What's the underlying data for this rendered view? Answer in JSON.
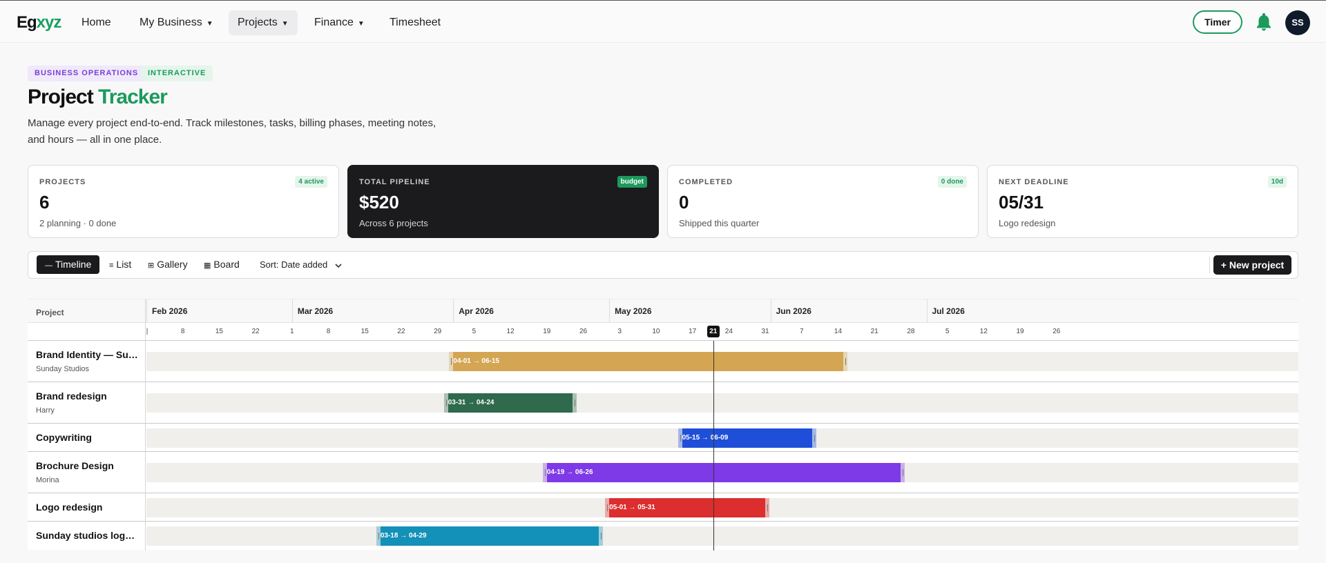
{
  "brand": {
    "prefix": "Eg",
    "suffix": "xyz"
  },
  "nav": [
    {
      "label": "Home",
      "dropdown": false
    },
    {
      "label": "My Business",
      "dropdown": true
    },
    {
      "label": "Projects",
      "dropdown": true,
      "active": true
    },
    {
      "label": "Finance",
      "dropdown": true
    },
    {
      "label": "Timesheet",
      "dropdown": false
    }
  ],
  "header": {
    "timer_label": "Timer",
    "bell_icon": "bell-icon",
    "avatar_initials": "SS"
  },
  "badges": {
    "category": "BUSINESS OPERATIONS",
    "mode": "INTERACTIVE"
  },
  "page": {
    "title_main": "Project",
    "title_accent": "Tracker",
    "description": "Manage every project end-to-end. Track milestones, tasks, billing phases, meeting notes, and hours — all in one place."
  },
  "stats": [
    {
      "label": "PROJECTS",
      "value": "6",
      "sub": "2 planning · 0 done",
      "tag": "4 active"
    },
    {
      "label": "TOTAL PIPELINE",
      "value": "$520",
      "sub": "Across 6 projects",
      "tag": "budget"
    },
    {
      "label": "COMPLETED",
      "value": "0",
      "sub": "Shipped this quarter",
      "tag": "0 done"
    },
    {
      "label": "NEXT DEADLINE",
      "value": "05/31",
      "sub": "Logo redesign",
      "tag": "10d"
    }
  ],
  "views": [
    {
      "label": "Timeline",
      "icon": "—",
      "active": true
    },
    {
      "label": "List",
      "icon": "≡"
    },
    {
      "label": "Gallery",
      "icon": "⊞"
    },
    {
      "label": "Board",
      "icon": "▦"
    }
  ],
  "sort_label": "Sort: Date added",
  "new_project_label": "+ New project",
  "timeline": {
    "column_label": "Project",
    "months": [
      "Feb 2026",
      "Mar 2026",
      "Apr 2026",
      "May 2026",
      "Jun 2026",
      "Jul 2026"
    ],
    "day_ticks": [
      "1",
      "8",
      "15",
      "22",
      "1",
      "8",
      "15",
      "22",
      "29",
      "5",
      "12",
      "19",
      "26",
      "3",
      "10",
      "17",
      "21",
      "24",
      "31",
      "7",
      "14",
      "21",
      "28",
      "5",
      "12",
      "19",
      "26"
    ],
    "today": "21",
    "projects": [
      {
        "name": "Brand Identity — Sunday Studios",
        "owner": "Sunday Studios",
        "start": "2026-04-01",
        "end": "2026-06-15",
        "range_label": "04-01 → 06-15",
        "color": "#d4a653"
      },
      {
        "name": "Brand redesign",
        "owner": "Harry",
        "start": "2026-03-31",
        "end": "2026-04-24",
        "range_label": "03-31 → 04-24",
        "color": "#2e6a4b"
      },
      {
        "name": "Copywriting",
        "owner": "",
        "start": "2026-05-15",
        "end": "2026-06-09",
        "range_label": "05-15 → 06-09",
        "color": "#1f4fd8"
      },
      {
        "name": "Brochure Design",
        "owner": "Morina",
        "start": "2026-04-19",
        "end": "2026-06-26",
        "range_label": "04-19 → 06-26",
        "color": "#7e3ae6"
      },
      {
        "name": "Logo redesign",
        "owner": "",
        "start": "2026-05-01",
        "end": "2026-05-31",
        "range_label": "05-01 → 05-31",
        "color": "#dc2e2e"
      },
      {
        "name": "Sunday studios logo redesign",
        "owner": "",
        "start": "2026-03-18",
        "end": "2026-04-29",
        "range_label": "03-18 → 04-29",
        "color": "#1391b8"
      }
    ]
  }
}
